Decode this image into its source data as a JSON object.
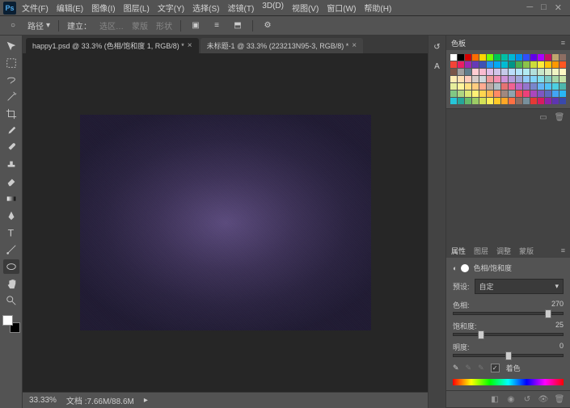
{
  "menu": [
    "文件(F)",
    "编辑(E)",
    "图像(I)",
    "图层(L)",
    "文字(Y)",
    "选择(S)",
    "滤镜(T)",
    "3D(D)",
    "视图(V)",
    "窗口(W)",
    "帮助(H)"
  ],
  "optionsbar": {
    "path_label": "路径",
    "build_label": "建立：",
    "selection": "选区…",
    "mask": "蒙版",
    "shape": "形状"
  },
  "tabs": [
    {
      "label": "happy1.psd @ 33.3% (色相/饱和度 1, RGB/8) *",
      "active": true
    },
    {
      "label": "未标题-1 @ 33.3% (223213N95-3, RGB/8) *",
      "active": false
    }
  ],
  "status": {
    "zoom": "33.33%",
    "doc": "文档 :7.66M/88.6M"
  },
  "swatches_panel": {
    "title": "色板"
  },
  "swatch_colors": [
    "#ffffff",
    "#000000",
    "#d50000",
    "#ff6d00",
    "#ffd600",
    "#76ff03",
    "#00c853",
    "#00bfa5",
    "#00b8d4",
    "#0091ea",
    "#304ffe",
    "#6200ea",
    "#aa00ff",
    "#c51162",
    "#bfa56e",
    "#8d6e63",
    "#f44336",
    "#e91e63",
    "#9c27b0",
    "#673ab7",
    "#3f51b5",
    "#2196f3",
    "#03a9f4",
    "#00bcd4",
    "#009688",
    "#4caf50",
    "#8bc34a",
    "#cddc39",
    "#ffeb3b",
    "#ffc107",
    "#ff9800",
    "#ff5722",
    "#795548",
    "#9e9e9e",
    "#607d8b",
    "#ffcdd2",
    "#f8bbd0",
    "#e1bee7",
    "#d1c4e9",
    "#c5cae9",
    "#bbdefb",
    "#b3e5fc",
    "#b2ebf2",
    "#b2dfdb",
    "#c8e6c9",
    "#dcedc8",
    "#f0f4c3",
    "#fff9c4",
    "#ffecb3",
    "#ffe0b2",
    "#ffccbc",
    "#d7ccc8",
    "#cfd8dc",
    "#ef9a9a",
    "#f48fb1",
    "#ce93d8",
    "#b39ddb",
    "#9fa8da",
    "#90caf9",
    "#81d4fa",
    "#80deea",
    "#80cbc4",
    "#a5d6a7",
    "#c5e1a5",
    "#e6ee9c",
    "#fff59d",
    "#ffe082",
    "#ffcc80",
    "#ffab91",
    "#bcaaa4",
    "#b0bec5",
    "#e57373",
    "#f06292",
    "#ba68c8",
    "#9575cd",
    "#7986cb",
    "#64b5f6",
    "#4fc3f7",
    "#4dd0e1",
    "#4db6ac",
    "#81c784",
    "#aed581",
    "#dce775",
    "#fff176",
    "#ffd54f",
    "#ffb74d",
    "#ff8a65",
    "#a1887f",
    "#90a4ae",
    "#ef5350",
    "#ec407a",
    "#ab47bc",
    "#7e57c2",
    "#5c6bc0",
    "#42a5f5",
    "#29b6f6",
    "#26c6da",
    "#26a69a",
    "#66bb6a",
    "#9ccc65",
    "#d4e157",
    "#ffee58",
    "#ffca28",
    "#ffa726",
    "#ff7043",
    "#8d6e63",
    "#78909c",
    "#e53935",
    "#d81b60",
    "#8e24aa",
    "#5e35b1",
    "#3949ab"
  ],
  "properties": {
    "tabs": [
      "属性",
      "图层",
      "调整",
      "蒙版"
    ],
    "adj_name": "色相/饱和度",
    "preset_label": "预设:",
    "preset_value": "自定",
    "hue_label": "色相:",
    "hue_value": "270",
    "sat_label": "饱和度:",
    "sat_value": "25",
    "light_label": "明度:",
    "light_value": "0",
    "colorize_label": "着色"
  }
}
